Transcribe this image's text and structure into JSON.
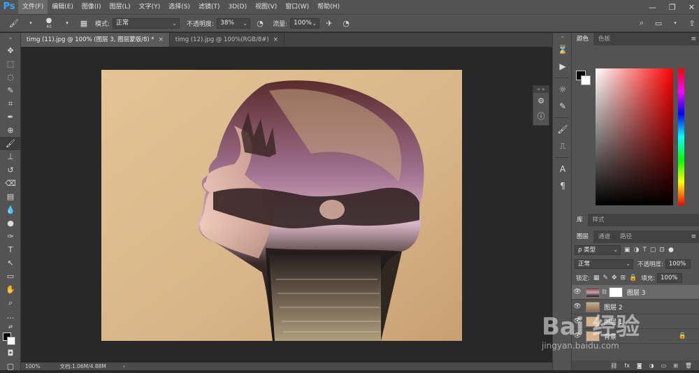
{
  "app": {
    "logo": "Ps"
  },
  "menu": [
    "文件(F)",
    "编辑(E)",
    "图像(I)",
    "图层(L)",
    "文字(Y)",
    "选择(S)",
    "滤镜(T)",
    "3D(D)",
    "视图(V)",
    "窗口(W)",
    "帮助(H)"
  ],
  "window_controls": {
    "minimize": "—",
    "restore": "❐",
    "close": "✕"
  },
  "options": {
    "brush_size": "40",
    "mode_label": "模式:",
    "mode_value": "正常",
    "opacity_label": "不透明度:",
    "opacity_value": "38%",
    "flow_label": "流量:",
    "flow_value": "100%"
  },
  "tabs": [
    {
      "label": "timg (11).jpg @ 100% (图层 3, 图层蒙版/8) *",
      "close": "×"
    },
    {
      "label": "timg (12).jpg @ 100%(RGB/8#)",
      "close": "×"
    }
  ],
  "status": {
    "zoom": "100%",
    "doc": "文档:1.06M/4.88M",
    "arrow": "›"
  },
  "color_panel": {
    "tabs": [
      "颜色",
      "色板"
    ]
  },
  "library_panel": {
    "tabs": [
      "库",
      "样式"
    ]
  },
  "layers_panel": {
    "tabs": [
      "图层",
      "通道",
      "路径"
    ],
    "filter_value": "ρ 类型",
    "blend_mode": "正常",
    "opacity_label": "不透明度:",
    "opacity_value": "100%",
    "lock_label": "锁定:",
    "fill_label": "填充:",
    "fill_value": "100%",
    "layers": [
      {
        "name": "图层 3",
        "selected": true
      },
      {
        "name": "图层 2",
        "selected": false
      },
      {
        "name": "图层 1",
        "selected": false
      },
      {
        "name": "背景",
        "selected": false
      }
    ]
  },
  "watermark": {
    "text": "Bai 经验",
    "url": "jingyan.baidu.com"
  },
  "colors": {
    "accent": "#31a8ff",
    "panel": "#535353",
    "canvas": "#282828"
  }
}
